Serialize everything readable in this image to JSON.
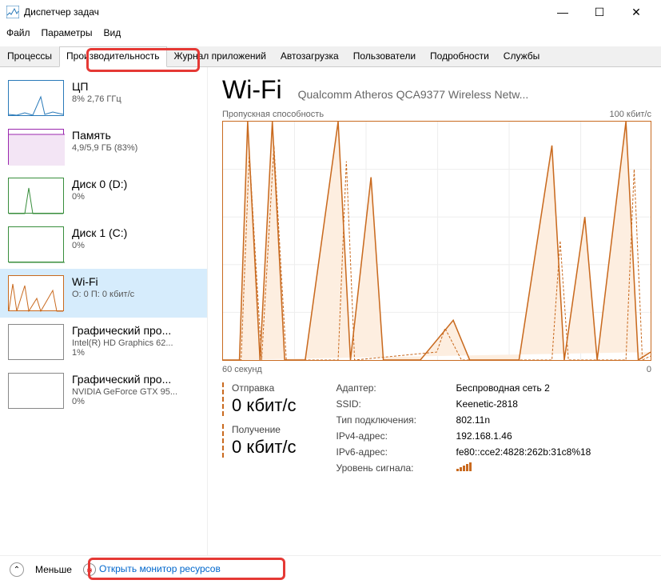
{
  "window": {
    "title": "Диспетчер задач",
    "minimize": "—",
    "maximize": "☐",
    "close": "✕"
  },
  "menu": {
    "file": "Файл",
    "options": "Параметры",
    "view": "Вид"
  },
  "tabs": {
    "processes": "Процессы",
    "performance": "Производительность",
    "apphistory": "Журнал приложений",
    "startup": "Автозагрузка",
    "users": "Пользователи",
    "details": "Подробности",
    "services": "Службы"
  },
  "sidebar": [
    {
      "name": "ЦП",
      "sub": "8% 2,76 ГГц"
    },
    {
      "name": "Память",
      "sub": "4,9/5,9 ГБ (83%)"
    },
    {
      "name": "Диск 0 (D:)",
      "sub": "0%"
    },
    {
      "name": "Диск 1 (C:)",
      "sub": "0%"
    },
    {
      "name": "Wi-Fi",
      "sub": "О: 0 П: 0 кбит/с"
    },
    {
      "name": "Графический про...",
      "sub": "Intel(R) HD Graphics 62...\n1%"
    },
    {
      "name": "Графический про...",
      "sub": "NVIDIA GeForce GTX 95...\n0%"
    }
  ],
  "detail": {
    "title": "Wi-Fi",
    "adapter_full": "Qualcomm Atheros QCA9377 Wireless Netw...",
    "chart_title": "Пропускная способность",
    "chart_max": "100 кбит/с",
    "x_left": "60 секунд",
    "x_right": "0",
    "send_label": "Отправка",
    "send_value": "0 кбит/с",
    "recv_label": "Получение",
    "recv_value": "0 кбит/с",
    "props": {
      "adapter_l": "Адаптер:",
      "adapter_v": "Беспроводная сеть 2",
      "ssid_l": "SSID:",
      "ssid_v": "Keenetic-2818",
      "conn_l": "Тип подключения:",
      "conn_v": "802.11n",
      "ipv4_l": "IPv4-адрес:",
      "ipv4_v": "192.168.1.46",
      "ipv6_l": "IPv6-адрес:",
      "ipv6_v": "fe80::cce2:4828:262b:31c8%18",
      "signal_l": "Уровень сигнала:"
    }
  },
  "footer": {
    "less": "Меньше",
    "monitor": "Открыть монитор ресурсов"
  }
}
